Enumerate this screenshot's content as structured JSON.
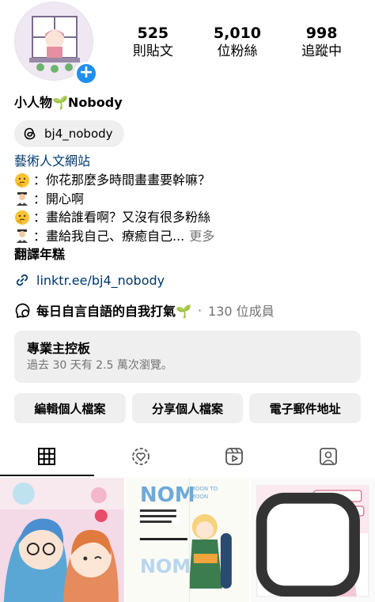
{
  "stats": [
    {
      "value": "525",
      "label": "則貼文"
    },
    {
      "value": "5,010",
      "label": "位粉絲"
    },
    {
      "value": "998",
      "label": "追蹤中"
    }
  ],
  "profile": {
    "name": "小人物🌱Nobody",
    "threads_handle": "bj4_nobody",
    "category": "藝術人文網站",
    "bio": [
      {
        "emoji": "thinking",
        "text": "：你花那麼多時間畫畫要幹嘛？"
      },
      {
        "emoji": "person",
        "text": "：開心啊"
      },
      {
        "emoji": "thinking",
        "text": "：畫給誰看啊？又沒有很多粉絲"
      },
      {
        "emoji": "person",
        "text": "：畫給我自己、療癒自己..."
      }
    ],
    "more_label": "更多",
    "bio_footer": "翻譯年糕",
    "link": "linktr.ee/bj4_nobody"
  },
  "channel": {
    "title": "每日自言自語的自我打氣🌱",
    "separator": "·",
    "members": "130 位成員"
  },
  "dashboard": {
    "title": "專業主控板",
    "subtitle": "過去 30 天有 2.5 萬次瀏覽。"
  },
  "buttons": {
    "edit": "編輯個人檔案",
    "share": "分享個人檔案",
    "email": "電子郵件地址"
  },
  "tabs": [
    {
      "icon": "grid-icon",
      "active": true
    },
    {
      "icon": "reels-circle-icon",
      "active": false
    },
    {
      "icon": "reels-icon",
      "active": false
    },
    {
      "icon": "tagged-icon",
      "active": false
    }
  ],
  "posts": [
    {
      "theme": "couple-illustration"
    },
    {
      "theme": "nom-poster"
    },
    {
      "theme": "comic-panel"
    }
  ],
  "colors": {
    "accent_blue": "#1f8ff0",
    "link_blue": "#00376b",
    "muted": "#737373",
    "pill_bg": "#efefef"
  }
}
